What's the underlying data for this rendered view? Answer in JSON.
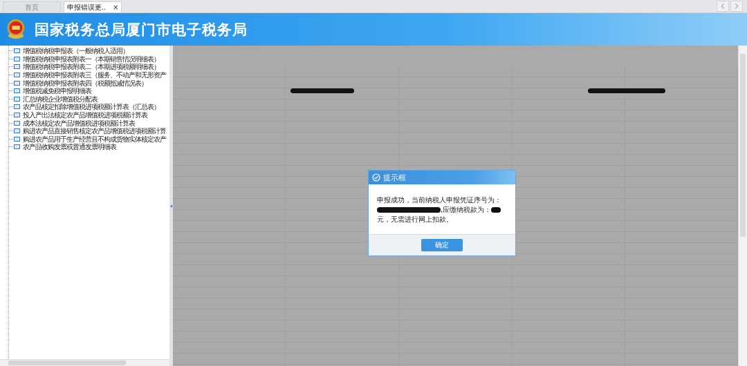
{
  "tabs": [
    {
      "label": "首页",
      "selected": false
    },
    {
      "label": "申报错误更..",
      "selected": true,
      "close": "×"
    }
  ],
  "header": {
    "title": "国家税务总局厦门市电子税务局"
  },
  "sidebar": {
    "items": [
      {
        "label": "增值税纳税申报表（一般纳税人适用）"
      },
      {
        "label": "增值税纳税申报表附表一（本期销售情况明细表）"
      },
      {
        "label": "增值税纳税申报表附表二（本期进项税额明细表）"
      },
      {
        "label": "增值税纳税申报表附表三（服务、不动产和无形资产"
      },
      {
        "label": "增值税纳税申报表附表四（税额抵减情况表）"
      },
      {
        "label": "增值税减免税申报明细表"
      },
      {
        "label": "汇总纳税企业增值税分配表"
      },
      {
        "label": "农产品核定扣除增值税进项税额计算表（汇总表）"
      },
      {
        "label": "投入产出法核定农产品增值税进项税额计算表"
      },
      {
        "label": "成本法核定农产品增值税进项税额计算表"
      },
      {
        "label": "购进农产品直接销售核定农产品增值税进项税额计算"
      },
      {
        "label": "购进农产品用于生产经营且不构成货物实体核定农产"
      },
      {
        "label": "农产品收购发票或普通发票明细表"
      }
    ]
  },
  "form": {
    "redactions": [
      {
        "kind": "redaction"
      },
      {
        "kind": "redaction"
      }
    ]
  },
  "dialog": {
    "title": "提示框",
    "message": [
      {
        "kind": "text",
        "text": "申报成功，当前纳税人申报凭证序号为："
      },
      {
        "kind": "long-redaction"
      },
      {
        "kind": "text",
        "text": ",应缴纳税款为："
      },
      {
        "kind": "short-redaction"
      },
      {
        "kind": "text",
        "text": "元，无需进行网上扣款。"
      }
    ],
    "button": "确定"
  }
}
